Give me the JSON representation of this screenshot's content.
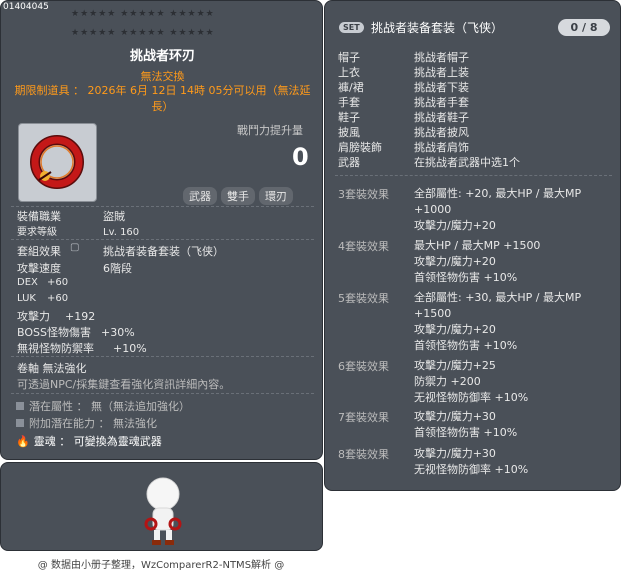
{
  "item": {
    "id": "01404045",
    "stars_row1": "★★★★★  ★★★★★  ★★★★★",
    "stars_row2": "★★★★★  ★★★★★  ★★★★★",
    "name": "挑战者环刃",
    "trade_note": "無法交換",
    "expire": "期限制道具 ： 2026年 6月 12日 14時 05分可以用（無法延長）",
    "power_label": "戰鬥力提升量",
    "power_value": "0",
    "tags": [
      "武器",
      "雙手",
      "環刃"
    ],
    "job_label": "裝備職業",
    "job_value": "盜賊",
    "req_label": "要求等級",
    "req_value": "Lv. 160",
    "set_label": "套組效果",
    "set_value": "挑战者装备套装（飞侠）",
    "speed_label": "攻擊速度",
    "speed_value": "6階段",
    "dex_label": "DEX",
    "dex_value": "+60",
    "luk_label": "LUK",
    "luk_value": "+60",
    "atk_label": "攻擊力",
    "atk_value": "+192",
    "boss_label": "BOSS怪物傷害",
    "boss_value": "+30%",
    "ignore_label": "無視怪物防禦率",
    "ignore_value": "+10%",
    "scroll": "卷軸 無法強化",
    "npc_note": "可透過NPC/採集鍵查看強化資訊詳細內容。",
    "potential": "潛在屬性 ： 無（無法追加強化）",
    "bonus_potential": "附加潛在能力 ： 無法強化",
    "soul": "靈魂 ： 可變換為靈魂武器"
  },
  "set": {
    "badge": "SET",
    "title": "挑战者装备套装（飞侠）",
    "count": "0 / 8",
    "parts": [
      {
        "slot": "帽子",
        "name": "挑战者帽子"
      },
      {
        "slot": "上衣",
        "name": "挑战者上装"
      },
      {
        "slot": "褲/裙",
        "name": "挑战者下装"
      },
      {
        "slot": "手套",
        "name": "挑战者手套"
      },
      {
        "slot": "鞋子",
        "name": "挑战者鞋子"
      },
      {
        "slot": "披風",
        "name": "挑战者披风"
      },
      {
        "slot": "肩膀裝飾",
        "name": "挑战者肩饰"
      },
      {
        "slot": "武器",
        "name": "在挑战者武器中选1个"
      }
    ],
    "effects": [
      {
        "label": "3套裝效果",
        "lines": [
          "全部屬性: +20, 最大HP / 最大MP +1000",
          "攻擊力/魔力+20"
        ]
      },
      {
        "label": "4套裝效果",
        "lines": [
          "最大HP / 最大MP +1500",
          "攻擊力/魔力+20",
          "首领怪物伤害 +10%"
        ]
      },
      {
        "label": "5套裝效果",
        "lines": [
          "全部屬性: +30, 最大HP / 最大MP +1500",
          "攻擊力/魔力+20",
          "首领怪物伤害 +10%"
        ]
      },
      {
        "label": "6套裝效果",
        "lines": [
          "攻擊力/魔力+25",
          "防禦力 +200",
          "无视怪物防御率 +10%"
        ]
      },
      {
        "label": "7套裝效果",
        "lines": [
          "攻擊力/魔力+30",
          "首领怪物伤害 +10%"
        ]
      },
      {
        "label": "8套裝效果",
        "lines": [
          "攻擊力/魔力+30",
          "无视怪物防御率 +10%"
        ]
      }
    ]
  },
  "footer": "@ 数据由小册子整理，WzComparerR2-NTMS解析 @",
  "colors": {
    "panel": "#4a5058",
    "orange": "#ff9a1a",
    "ring": "#b31414"
  }
}
